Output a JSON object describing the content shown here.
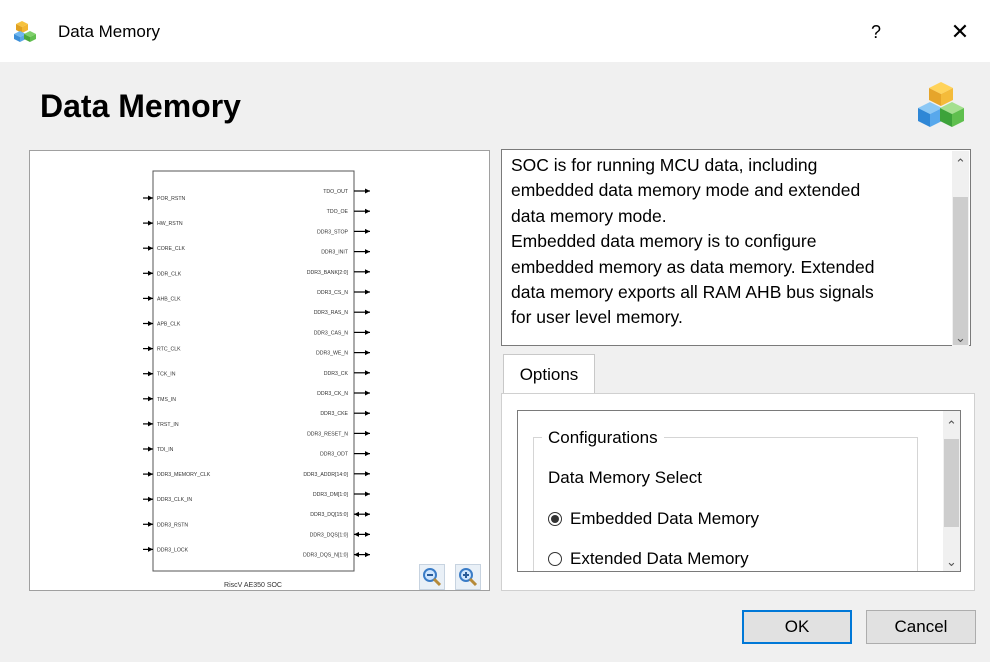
{
  "window": {
    "title": "Data Memory",
    "help_label": "?",
    "close_label": "✕"
  },
  "header": {
    "title": "Data Memory"
  },
  "diagram": {
    "block_label": "RiscV AE350 SOC",
    "left_pins": [
      "POR_RSTN",
      "HW_RSTN",
      "CORE_CLK",
      "DDR_CLK",
      "AHB_CLK",
      "APB_CLK",
      "RTC_CLK",
      "TCK_IN",
      "TMS_IN",
      "TRST_IN",
      "TDI_IN",
      "DDR3_MEMORY_CLK",
      "DDR3_CLK_IN",
      "DDR3_RSTN",
      "DDR3_LOCK"
    ],
    "right_pins": [
      "TDO_OUT",
      "TDO_OE",
      "DDR3_STOP",
      "DDR3_INIT",
      "DDR3_BANK[2:0]",
      "DDR3_CS_N",
      "DDR3_RAS_N",
      "DDR3_CAS_N",
      "DDR3_WE_N",
      "DDR3_CK",
      "DDR3_CK_N",
      "DDR3_CKE",
      "DDR3_RESET_N",
      "DDR3_ODT",
      "DDR3_ADDR[14:0]",
      "DDR3_DM[1:0]",
      "DDR3_DQ[15:0]",
      "DDR3_DQS[1:0]",
      "DDR3_DQS_N[1:0]"
    ]
  },
  "description": {
    "text": "SOC is for running MCU data, including\nembedded data memory mode and extended\ndata memory mode.\n    Embedded data memory is to configure\nembedded memory as data memory. Extended\ndata memory exports all RAM AHB bus signals\nfor user level memory."
  },
  "tabs": [
    {
      "label": "Options"
    }
  ],
  "options": {
    "group_title": "Configurations",
    "field_label": "Data Memory Select",
    "choices": [
      {
        "label": "Embedded Data Memory",
        "selected": true
      },
      {
        "label": "Extended Data Memory",
        "selected": false
      }
    ]
  },
  "buttons": {
    "ok": "OK",
    "cancel": "Cancel"
  },
  "colors": {
    "accent": "#0078d7",
    "pin_line": "#000000"
  }
}
